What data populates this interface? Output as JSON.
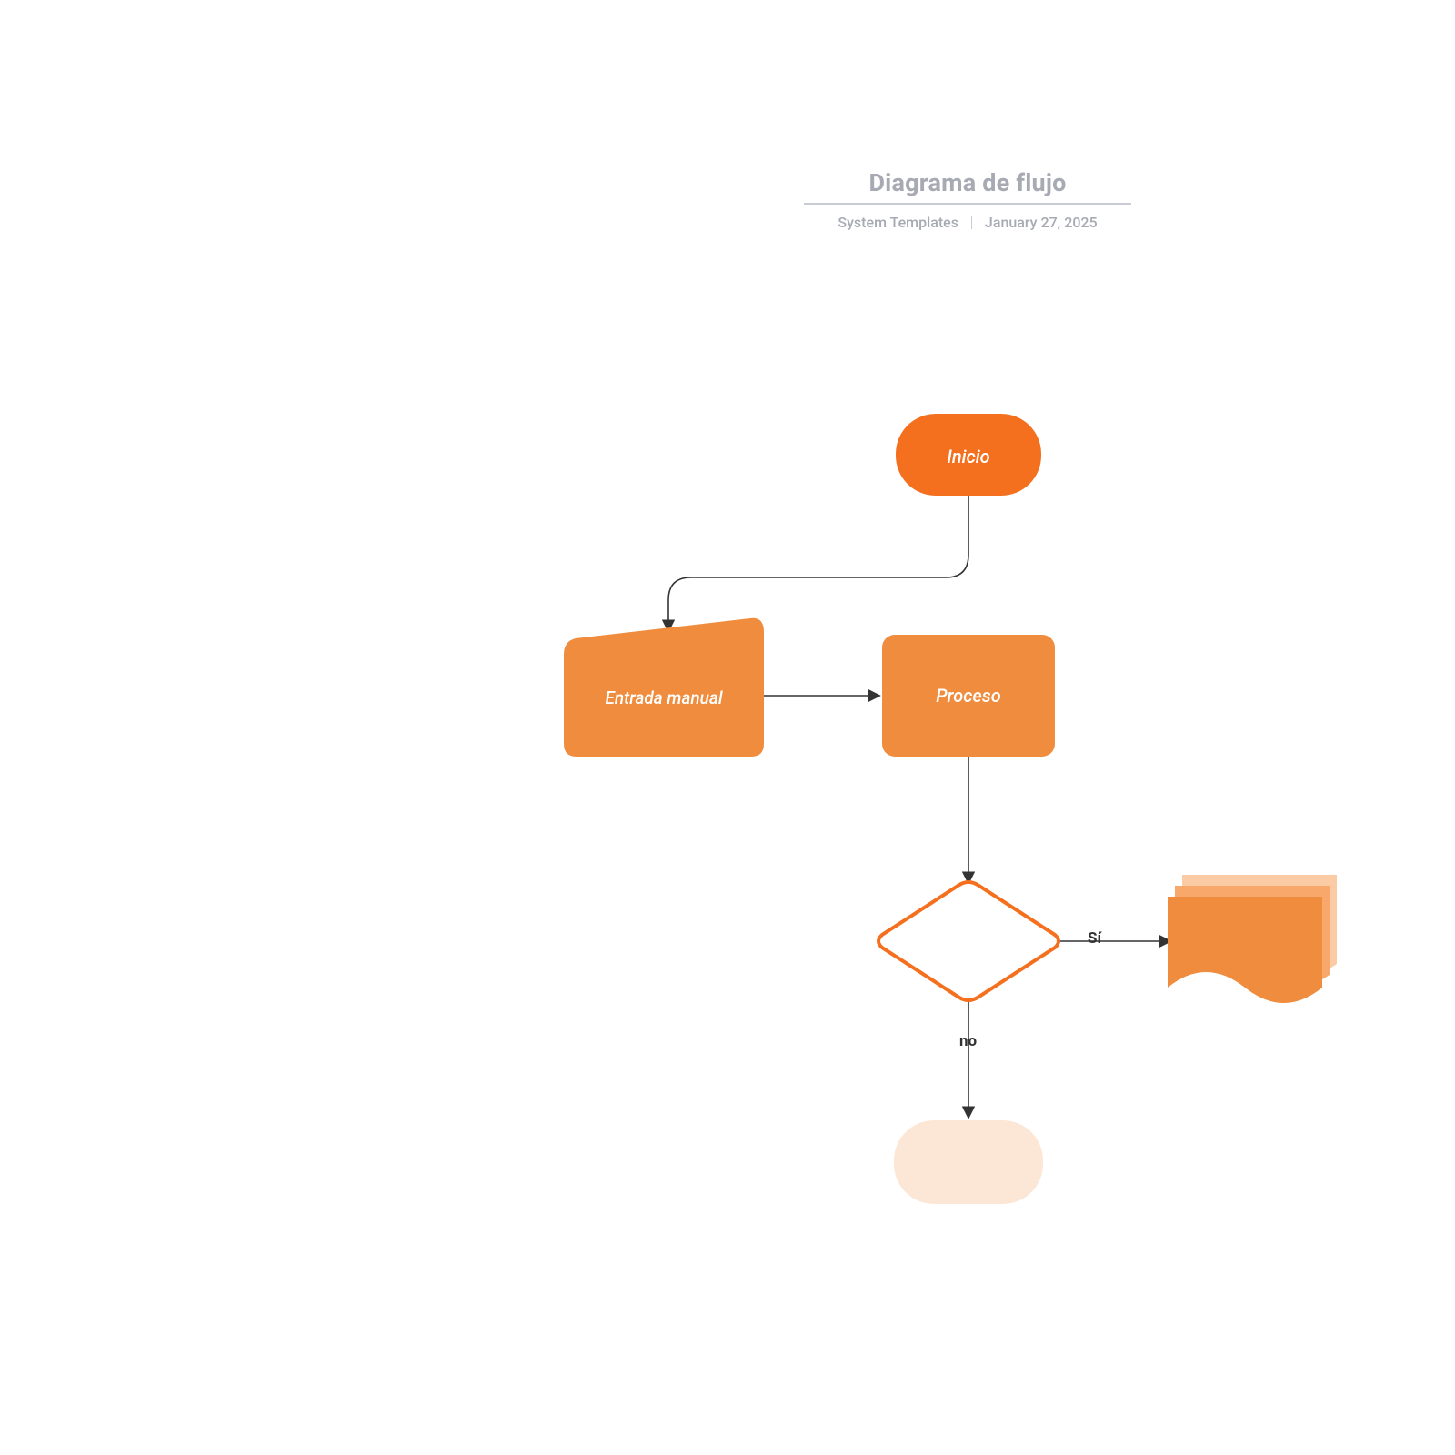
{
  "header": {
    "title": "Diagrama de flujo",
    "author": "System Templates",
    "date": "January 27, 2025"
  },
  "nodes": {
    "start": {
      "label": "Inicio",
      "type": "terminator",
      "color": "#F4701E"
    },
    "manual": {
      "label": "Entrada manual",
      "type": "manual-input",
      "color": "#F08C3E"
    },
    "process": {
      "label": "Proceso",
      "type": "process",
      "color": "#F08C3E"
    },
    "decision": {
      "label": "",
      "type": "decision",
      "stroke": "#F4701E",
      "fill": "#FFFFFF"
    },
    "documents": {
      "label": "",
      "type": "multi-document",
      "color": "#F08C3E"
    },
    "end": {
      "label": "",
      "type": "terminator",
      "color": "#FCE7D7"
    }
  },
  "edges": {
    "start_to_manual": {
      "from": "start",
      "to": "manual",
      "label": ""
    },
    "manual_to_process": {
      "from": "manual",
      "to": "process",
      "label": ""
    },
    "process_to_decision": {
      "from": "process",
      "to": "decision",
      "label": ""
    },
    "decision_yes": {
      "from": "decision",
      "to": "documents",
      "label": "Sí"
    },
    "decision_no": {
      "from": "decision",
      "to": "end",
      "label": "no"
    }
  },
  "colors": {
    "accent": "#F4701E",
    "node": "#F08C3E",
    "nodeLight": "#FCE7D7",
    "line": "#5E5E5E",
    "muted": "#A7AAB3"
  }
}
